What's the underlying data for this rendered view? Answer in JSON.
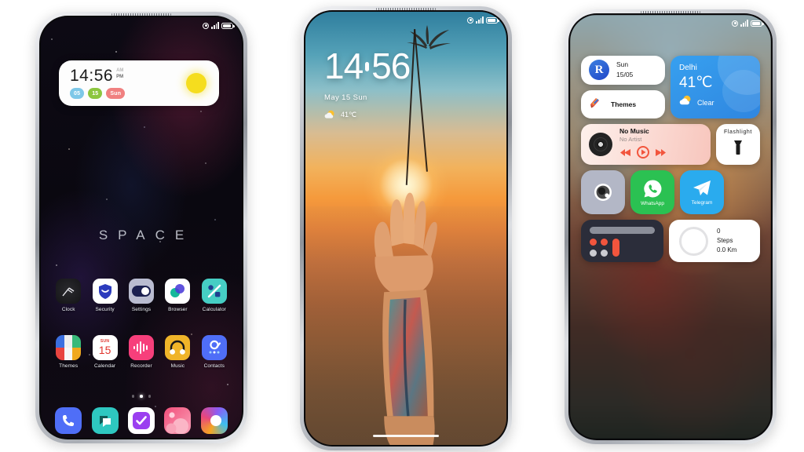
{
  "statusbar": {
    "punch_icon": "camera-punchhole-icon",
    "signal_icon": "signal-bars-icon",
    "battery_icon": "battery-icon"
  },
  "phone1": {
    "wallpaper_label": "SPACE",
    "clock_widget": {
      "time": "14:56",
      "am": "AM",
      "pm": "PM",
      "pills": [
        {
          "text": "05",
          "color": "#7ec8e8"
        },
        {
          "text": "15",
          "color": "#8cc63f"
        },
        {
          "text": "Sun",
          "color": "#f08080"
        }
      ],
      "sun_color": "#f5dd1e"
    },
    "apps_row1": [
      {
        "label": "Clock",
        "icon": "clock-icon"
      },
      {
        "label": "Security",
        "icon": "shield-icon"
      },
      {
        "label": "Settings",
        "icon": "toggle-switch-icon"
      },
      {
        "label": "Browser",
        "icon": "browser-icon"
      },
      {
        "label": "Calculator",
        "icon": "percent-icon"
      }
    ],
    "apps_row2": [
      {
        "label": "Themes",
        "icon": "themes-grid-icon"
      },
      {
        "label": "Calendar",
        "icon": "calendar-icon",
        "day_name": "SUN",
        "day_num": "15"
      },
      {
        "label": "Recorder",
        "icon": "waveform-icon"
      },
      {
        "label": "Music",
        "icon": "headphones-icon"
      },
      {
        "label": "Contacts",
        "icon": "contacts-icon"
      }
    ],
    "dock": [
      {
        "label": "Phone",
        "icon": "phone-icon"
      },
      {
        "label": "Messages",
        "icon": "message-icon"
      },
      {
        "label": "Notes",
        "icon": "checkmark-icon"
      },
      {
        "label": "Gallery",
        "icon": "gallery-icon"
      },
      {
        "label": "Camera",
        "icon": "camera-icon"
      }
    ],
    "page_dots": 3,
    "active_dot": 2
  },
  "phone2": {
    "time_hh": "14",
    "time_mm": "56",
    "date": "May 15  Sun",
    "temperature": "41℃",
    "weather_icon": "sun-cloud-icon",
    "home_indicator": "home-indicator"
  },
  "phone3": {
    "date_widget": {
      "logo": "R",
      "day": "Sun",
      "date": "15/05"
    },
    "themes_widget": {
      "label": "Themes",
      "icon": "themes-brush-icon"
    },
    "weather_widget": {
      "city": "Delhi",
      "temp": "41℃",
      "condition": "Clear",
      "icon": "sun-cloud-icon",
      "color": "#2f86e0"
    },
    "music_widget": {
      "title": "No Music",
      "artist": "No Artist",
      "prev_icon": "previous-track-icon",
      "play_icon": "play-icon",
      "next_icon": "next-track-icon",
      "accent": "#f2553d"
    },
    "flashlight_widget": {
      "label": "Flashlight",
      "icon": "flashlight-icon"
    },
    "apps": [
      {
        "label": "",
        "icon": "camera-icon"
      },
      {
        "label": "WhatsApp",
        "icon": "whatsapp-icon"
      },
      {
        "label": "Telegram",
        "icon": "telegram-icon"
      }
    ],
    "calculator_widget": {
      "icon": "calculator-icon"
    },
    "steps_widget": {
      "steps_value": "0",
      "steps_label": "Steps",
      "distance": "0.0 Km"
    }
  }
}
